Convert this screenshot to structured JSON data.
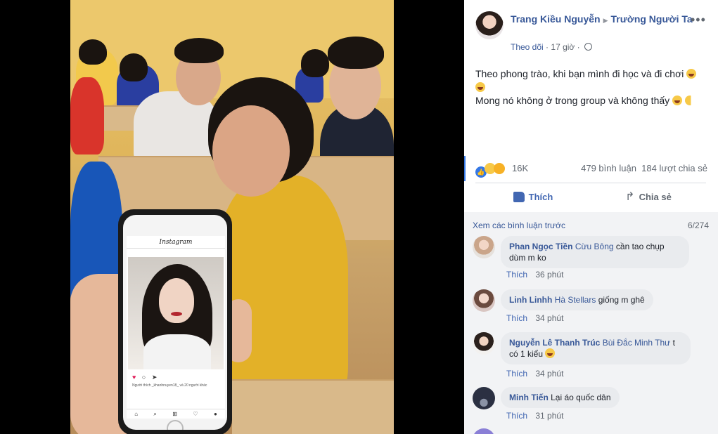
{
  "post": {
    "author": "Trang Kiều Nguyễn",
    "group": "Trường Người Ta",
    "follow": "Theo dõi",
    "time": "17 giờ",
    "separator": "·",
    "more": "•••",
    "text_line1": "Theo phong trào, khi bạn mình đi học và đi chơi",
    "text_line2": "Mong nó không ở trong group và không thấy"
  },
  "photo": {
    "instagram_title": "Instagram",
    "likes_text": "Người thích _khanhnuyen18_ và 20 người khác"
  },
  "stats": {
    "reactions": "16K",
    "comments": "479 bình luận",
    "shares": "184 lượt chia sẻ"
  },
  "actions": {
    "like": "Thích",
    "share": "Chia sẻ"
  },
  "comments_section": {
    "view_previous": "Xem các bình luận trước",
    "count": "6/274",
    "items": [
      {
        "name": "Phan Ngọc Tiền",
        "tag": "Cừu Bông",
        "text": "cần tao chụp dùm m ko",
        "like": "Thích",
        "time": "36 phút"
      },
      {
        "name": "Linh Linhh",
        "tag": "Hà Stellars",
        "text": "giống m ghê",
        "like": "Thích",
        "time": "34 phút"
      },
      {
        "name": "Nguyễn Lê Thanh Trúc",
        "tag": "Bùi Đắc Minh Thư",
        "text": "t có 1 kiểu",
        "like": "Thích",
        "time": "34 phút"
      },
      {
        "name": "Minh Tiến",
        "tag": "",
        "text": "Lại áo quốc dân",
        "like": "Thích",
        "time": "31 phút"
      }
    ]
  },
  "colors": {
    "link": "#385898",
    "accent": "#4267b2",
    "muted": "#606770"
  }
}
